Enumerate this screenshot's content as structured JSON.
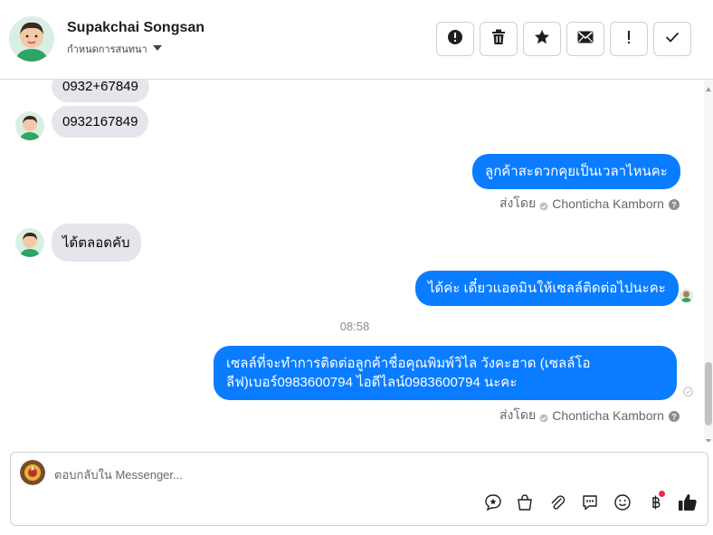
{
  "header": {
    "name": "Supakchai Songsan",
    "subtitle": "กำหนดการสนทนา",
    "toolbar": [
      "alert-circle-icon",
      "trash-icon",
      "star-icon",
      "envelope-icon",
      "exclamation-icon",
      "check-icon"
    ]
  },
  "messages": {
    "in_1": "0932+67849",
    "in_2": "0932167849",
    "out_1": "ลูกค้าสะดวกคุยเป็นเวลาไหนคะ",
    "in_3": "ได้ตลอดคับ",
    "out_2": "ได้ค่ะ เดี๋ยวแอดมินให้เซลล์ติดต่อไปนะคะ",
    "time": "08:58",
    "out_3_line1": "เซลล์ที่จะทำการติดต่อลูกค้าชื่อคุณพิมพ์วิไล วังคะฮาด (เซลล์โอ",
    "out_3_line2": "ลีฟ)เบอร์0983600794 ไอดีไลน์0983600794 นะคะ"
  },
  "sent_by": {
    "label": "ส่งโดย",
    "agent": "Chonticha Kamborn"
  },
  "composer": {
    "placeholder": "ตอบกลับใน Messenger..."
  },
  "colors": {
    "outgoing_bubble": "#0a7cff",
    "incoming_bubble": "#e4e6eb",
    "badge_dot": "#f02849"
  }
}
